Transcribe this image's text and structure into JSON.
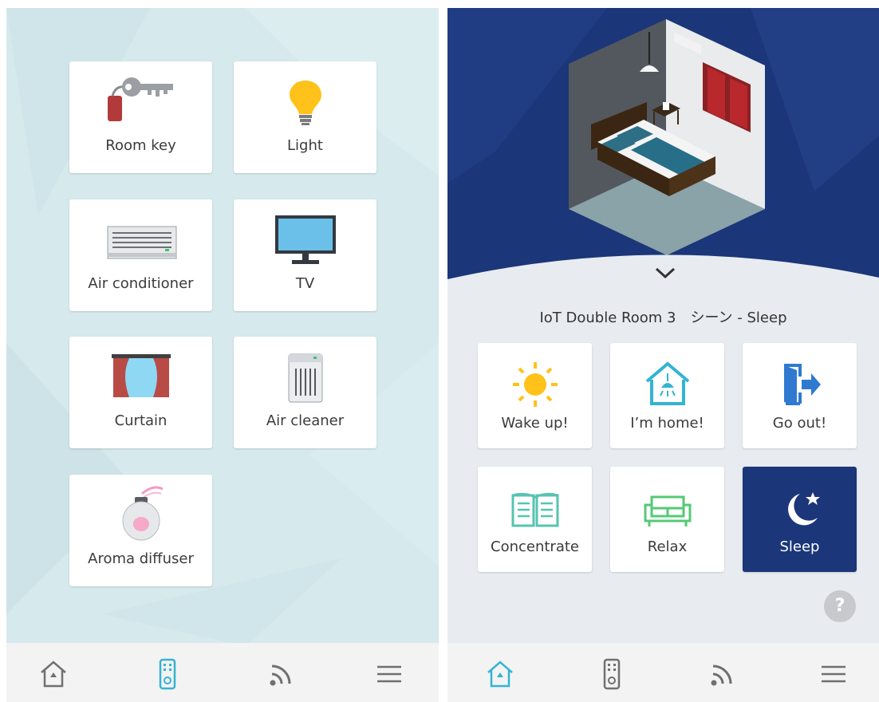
{
  "left_screen": {
    "devices": [
      {
        "label": "Room key",
        "icon": "key-icon"
      },
      {
        "label": "Light",
        "icon": "light-bulb-icon"
      },
      {
        "label": "Air conditioner",
        "icon": "air-conditioner-icon"
      },
      {
        "label": "TV",
        "icon": "tv-icon"
      },
      {
        "label": "Curtain",
        "icon": "curtain-icon"
      },
      {
        "label": "Air cleaner",
        "icon": "air-cleaner-icon"
      },
      {
        "label": "Aroma diffuser",
        "icon": "aroma-diffuser-icon"
      }
    ],
    "active_nav": "remote"
  },
  "right_screen": {
    "room_title": "IoT Double Room 3　シーン - Sleep",
    "scenes": [
      {
        "label": "Wake up!",
        "icon": "sun-icon"
      },
      {
        "label": "I’m home!",
        "icon": "home-light-icon"
      },
      {
        "label": "Go out!",
        "icon": "exit-door-icon"
      },
      {
        "label": "Concentrate",
        "icon": "book-icon"
      },
      {
        "label": "Relax",
        "icon": "sofa-icon"
      },
      {
        "label": "Sleep",
        "icon": "moon-star-icon",
        "active": true
      }
    ],
    "help_label": "?",
    "active_nav": "home"
  },
  "nav_items": [
    "home-icon",
    "remote-icon",
    "wifi-icon",
    "menu-icon"
  ],
  "colors": {
    "accent": "#33b4d3",
    "nav_inactive": "#707070",
    "header_blue": "#1b3679",
    "active_scene": "#1b3679",
    "left_bg": "#d6e9ec",
    "right_bg": "#e8ecf1"
  }
}
